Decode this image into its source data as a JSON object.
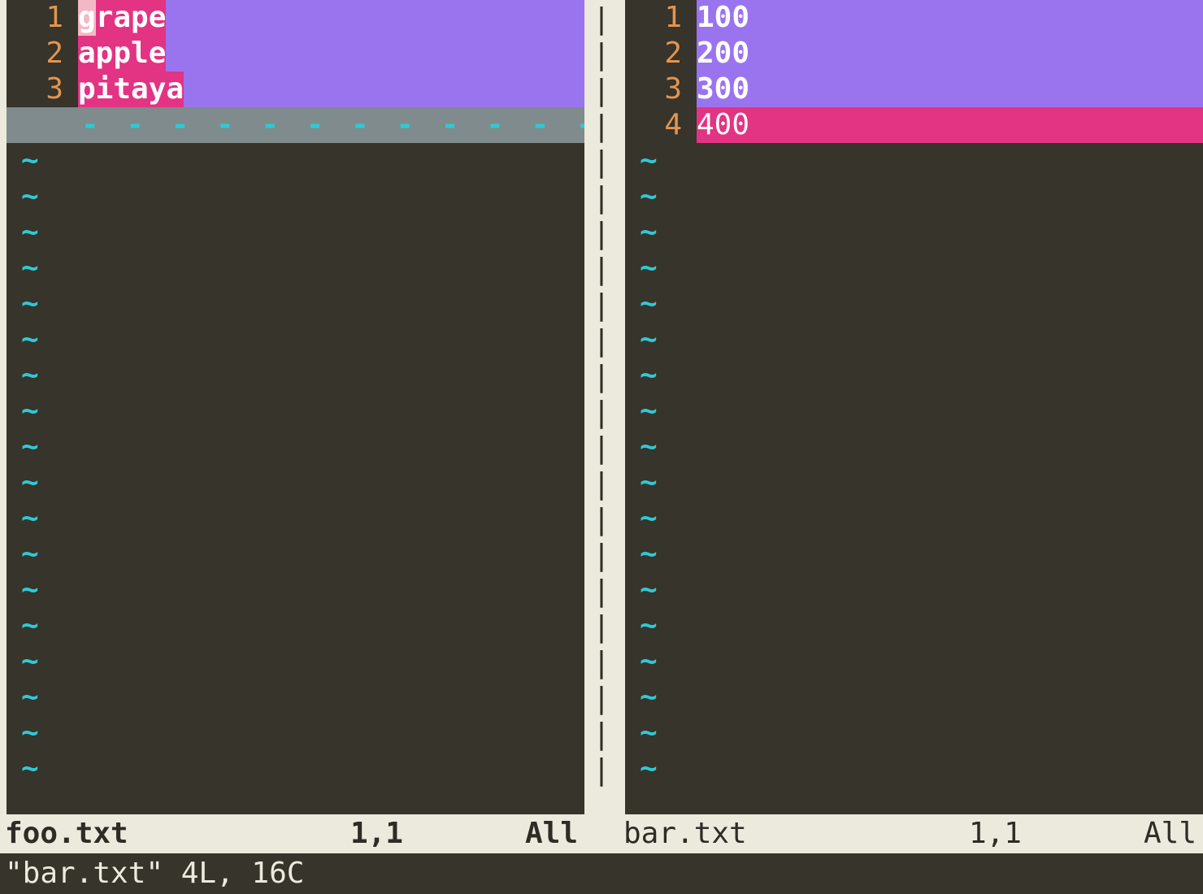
{
  "left": {
    "filename": "foo.txt",
    "active": true,
    "cursor_pos": "1,1",
    "scroll_pct": "All",
    "lines": [
      {
        "num": "1",
        "cursor": "g",
        "text": "rape",
        "type": "change"
      },
      {
        "num": "2",
        "cursor": "",
        "text": "apple",
        "type": "change"
      },
      {
        "num": "3",
        "cursor": "",
        "text": "pitaya",
        "type": "change"
      }
    ],
    "deleted_marker": "- - - - - - - - - - - - - - - - - - - - - - - - - - - - - - - - - - - - - - - - - - - - - - - - - - - - - - - - - - - - - -"
  },
  "right": {
    "filename": "bar.txt",
    "active": false,
    "cursor_pos": "1,1",
    "scroll_pct": "All",
    "lines": [
      {
        "num": "1",
        "text": "100",
        "type": "change"
      },
      {
        "num": "2",
        "text": "200",
        "type": "change"
      },
      {
        "num": "3",
        "text": "300",
        "type": "change"
      },
      {
        "num": "4",
        "text": "400",
        "type": "add"
      }
    ]
  },
  "tilde_glyph": "~",
  "vsplit_glyph": "|",
  "cmdline": "\"bar.txt\" 4L, 16C"
}
